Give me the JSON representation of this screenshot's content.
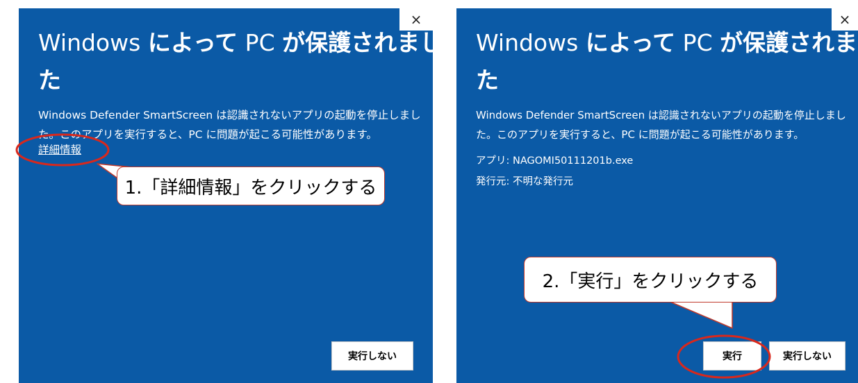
{
  "left_dialog": {
    "close_glyph": "×",
    "title_prefix": "Windows ",
    "title_bold1": "によって",
    "title_middle": " PC ",
    "title_bold2": "が保護されまし",
    "title_line2": "た",
    "description": "Windows Defender SmartScreen は認識されないアプリの起動を停止しました。このアプリを実行すると、PC に問題が起こる可能性があります。",
    "more_info_link": "詳細情報",
    "dont_run_button": "実行しない"
  },
  "right_dialog": {
    "close_glyph": "×",
    "title_prefix": "Windows ",
    "title_bold1": "によって",
    "title_middle": " PC ",
    "title_bold2": "が保護されまし",
    "title_line2": "た",
    "description": "Windows Defender SmartScreen は認識されないアプリの起動を停止しました。このアプリを実行すると、PC に問題が起こる可能性があります。",
    "app_label": "アプリ:",
    "app_value": "NAGOMI50111201b.exe",
    "publisher_label": "発行元:",
    "publisher_value": "不明な発行元",
    "run_button": "実行",
    "dont_run_button": "実行しない"
  },
  "annotations": {
    "callout1": "1.「詳細情報」をクリックする",
    "callout2": "2.「実行」をクリックする",
    "highlight_color": "#d9281c"
  }
}
